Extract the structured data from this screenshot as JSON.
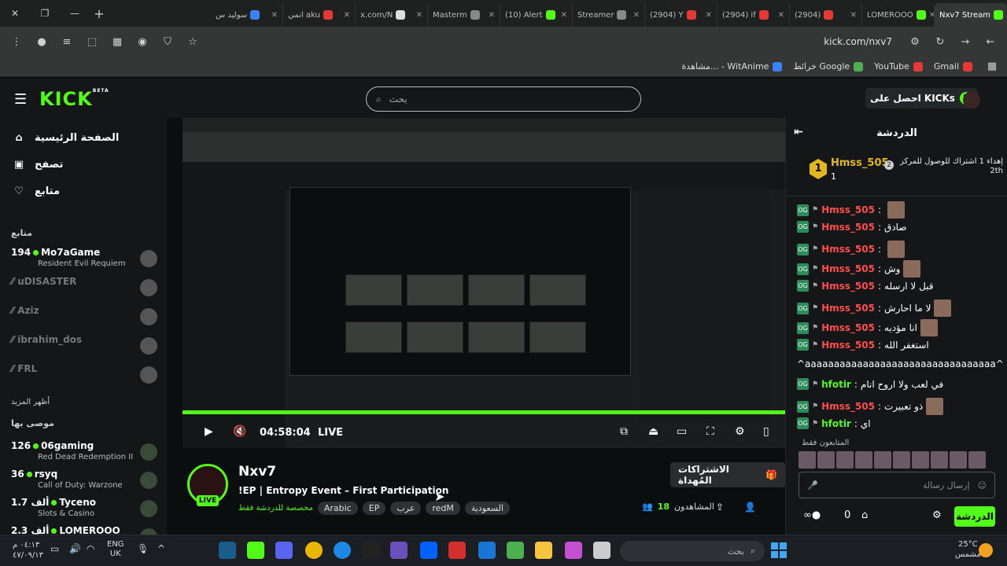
{
  "browser": {
    "tabs": [
      {
        "label": "Nxv7 Stream",
        "color": "#53fc18",
        "active": true
      },
      {
        "label": "LOMEROOO",
        "color": "#53fc18"
      },
      {
        "label": "(2904)",
        "color": "#e53935"
      },
      {
        "label": "(2904) if",
        "color": "#e53935"
      },
      {
        "label": "(2904) Y",
        "color": "#e53935"
      },
      {
        "label": "Streamer",
        "color": "#888"
      },
      {
        "label": "(10) Alert",
        "color": "#53fc18"
      },
      {
        "label": "Masterm",
        "color": "#888"
      },
      {
        "label": "x.com/N",
        "color": "#ddd"
      },
      {
        "label": "انمي aku",
        "color": "#e53935"
      },
      {
        "label": "سوليد س",
        "color": "#3b82f6"
      }
    ],
    "url": "kick.com/nxv7",
    "bookmarks": [
      {
        "label": "Gmail",
        "color": "#e53935"
      },
      {
        "label": "YouTube",
        "color": "#e53935"
      },
      {
        "label": "خرائط Google",
        "color": "#4caf50"
      },
      {
        "label": "مشاهدة... - WitAnime",
        "color": "#3b82f6"
      }
    ]
  },
  "header": {
    "logo": "KICK",
    "logo_beta": "BETA",
    "search_placeholder": "بحث",
    "get_kicks": "احصل على KICKs"
  },
  "sidebar": {
    "nav": [
      {
        "label": "الصفحة الرئيسية",
        "icon": "⌂"
      },
      {
        "label": "تصفح",
        "icon": "▣"
      },
      {
        "label": "متابع",
        "icon": "♡"
      }
    ],
    "following_title": "متابع",
    "following": [
      {
        "count": "194",
        "name": "Mo7aGame",
        "game": "Resident Evil Requiem",
        "online": true
      },
      {
        "name": "uDISASTER",
        "online": false
      },
      {
        "name": "Aziz",
        "online": false
      },
      {
        "name": "ibrahim_dos",
        "online": false
      },
      {
        "name": "FRL",
        "online": false
      }
    ],
    "show_more": "أظهر المزيد",
    "recommended_title": "موصى بها",
    "recommended": [
      {
        "count": "126",
        "name": "06gaming",
        "game": "Red Dead Redemption II"
      },
      {
        "count": "36",
        "name": "rsyq",
        "game": "Call of Duty: Warzone"
      },
      {
        "count": "1.7 ألف",
        "name": "Tyceno",
        "game": "Slots & Casino"
      },
      {
        "count": "2.3 ألف",
        "name": "LOMEROOO",
        "game": ""
      }
    ]
  },
  "player": {
    "time": "04:58:04",
    "live": "LIVE",
    "progress": 1.0
  },
  "stream": {
    "name": "Nxv7",
    "live_badge": "LIVE",
    "title": "!EP | Entropy Event – First Participation",
    "category": "مخصصة للدردشة فقط",
    "tags": [
      "Arabic",
      "EP",
      "عرب",
      "redM",
      "السعودية"
    ],
    "subs_button": "الاشتراكات المُهداة",
    "viewers_label": "المشاهدون",
    "viewers": "18"
  },
  "chat": {
    "title": "الدردشة",
    "pinned": {
      "rank": "1",
      "user": "Hmss_505",
      "count": "1",
      "rank2": "2",
      "text": "إهداء 1 اشتراك للوصول للمركز 2th"
    },
    "messages": [
      {
        "user": "Hmss_505",
        "color": "#ff4d4d",
        "text": "",
        "emote": true
      },
      {
        "user": "Hmss_505",
        "color": "#ff4d4d",
        "text": "صادق"
      },
      {
        "user": "Hmss_505",
        "color": "#ff4d4d",
        "text": "",
        "emote": true
      },
      {
        "user": "Hmss_505",
        "color": "#ff4d4d",
        "text": "وش",
        "emote": true
      },
      {
        "user": "Hmss_505",
        "color": "#ff4d4d",
        "text": "قبل لا ارسله"
      },
      {
        "user": "Hmss_505",
        "color": "#ff4d4d",
        "text": "لا ما احارش",
        "emote": true
      },
      {
        "user": "Hmss_505",
        "color": "#ff4d4d",
        "text": "انا مؤديه",
        "emote": true
      },
      {
        "user": "Hmss_505",
        "color": "#ff4d4d",
        "text": "استغفر الله"
      },
      {
        "user": "",
        "color": "#fff",
        "text": "^aaaaaaaaaaaaaaaaaaaaaaaaaaaaaaaaa^"
      },
      {
        "user": "hfotir",
        "color": "#53fc18",
        "text": "في لعب ولا اروح انام"
      },
      {
        "user": "Hmss_505",
        "color": "#ff4d4d",
        "text": "ذو تعبيرت",
        "emote": true
      },
      {
        "user": "hfotir",
        "color": "#53fc18",
        "text": "اي"
      }
    ],
    "subscribers_label": "المتابعون فقط",
    "input_placeholder": "إرسال رسالة",
    "send": "الدردشة",
    "kicks": "0"
  },
  "taskbar": {
    "time": "٠٤:١٣ م",
    "date": "٤٧/٠٩/١٣",
    "lang": "ENG",
    "lang2": "UK",
    "search": "بحث",
    "temp": "25°C",
    "weather": "مشمس"
  }
}
